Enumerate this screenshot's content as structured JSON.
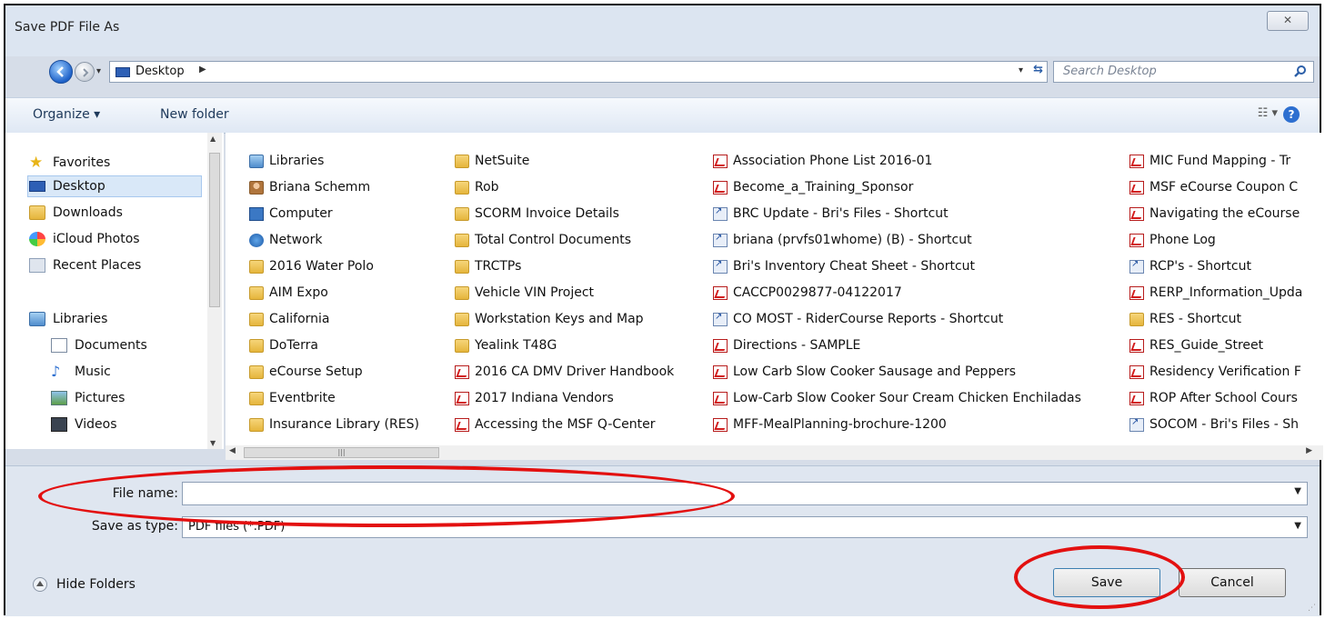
{
  "window": {
    "title": "Save PDF File As",
    "close_label": "✕"
  },
  "address_bar": {
    "location": "Desktop",
    "search_placeholder": "Search Desktop"
  },
  "toolbar": {
    "organize_label": "Organize ▾",
    "new_folder_label": "New folder",
    "views_label": "☷ ▾",
    "help_label": "?"
  },
  "nav_pane": {
    "items": [
      {
        "label": "Favorites",
        "icon": "star-icon"
      },
      {
        "label": "Desktop",
        "icon": "desktop-icon",
        "selected": true
      },
      {
        "label": "Downloads",
        "icon": "downloads-icon"
      },
      {
        "label": "iCloud Photos",
        "icon": "icloud-photos-icon"
      },
      {
        "label": "Recent Places",
        "icon": "recent-places-icon"
      },
      {
        "label": "Libraries",
        "icon": "libraries-icon"
      },
      {
        "label": "Documents",
        "icon": "documents-icon"
      },
      {
        "label": "Music",
        "icon": "music-icon"
      },
      {
        "label": "Pictures",
        "icon": "pictures-icon"
      },
      {
        "label": "Videos",
        "icon": "videos-icon"
      }
    ]
  },
  "files": {
    "columns": [
      [
        {
          "name": "Libraries",
          "icon": "library-icon"
        },
        {
          "name": "Briana Schemm",
          "icon": "user-folder-icon"
        },
        {
          "name": "Computer",
          "icon": "computer-icon"
        },
        {
          "name": "Network",
          "icon": "network-icon"
        },
        {
          "name": "2016 Water Polo",
          "icon": "folder-icon"
        },
        {
          "name": "AIM Expo",
          "icon": "folder-icon"
        },
        {
          "name": "California",
          "icon": "folder-icon"
        },
        {
          "name": "DoTerra",
          "icon": "folder-icon"
        },
        {
          "name": "eCourse Setup",
          "icon": "folder-icon"
        },
        {
          "name": "Eventbrite",
          "icon": "folder-icon"
        },
        {
          "name": "Insurance Library (RES)",
          "icon": "folder-icon"
        }
      ],
      [
        {
          "name": "NetSuite",
          "icon": "folder-icon"
        },
        {
          "name": "Rob",
          "icon": "folder-icon"
        },
        {
          "name": "SCORM Invoice Details",
          "icon": "folder-icon"
        },
        {
          "name": "Total Control Documents",
          "icon": "folder-icon"
        },
        {
          "name": "TRCTPs",
          "icon": "folder-icon"
        },
        {
          "name": "Vehicle VIN Project",
          "icon": "folder-icon"
        },
        {
          "name": "Workstation Keys and Map",
          "icon": "folder-icon"
        },
        {
          "name": "Yealink T48G",
          "icon": "folder-icon"
        },
        {
          "name": "2016 CA DMV Driver Handbook",
          "icon": "pdf-icon"
        },
        {
          "name": "2017 Indiana Vendors",
          "icon": "pdf-icon"
        },
        {
          "name": "Accessing the MSF Q-Center",
          "icon": "pdf-icon"
        }
      ],
      [
        {
          "name": "Association Phone List 2016-01",
          "icon": "pdf-icon"
        },
        {
          "name": "Become_a_Training_Sponsor",
          "icon": "pdf-icon"
        },
        {
          "name": "BRC Update - Bri's Files - Shortcut",
          "icon": "shortcut-icon"
        },
        {
          "name": "briana (prvfs01whome) (B) - Shortcut",
          "icon": "shortcut-icon"
        },
        {
          "name": "Bri's Inventory Cheat Sheet - Shortcut",
          "icon": "shortcut-icon"
        },
        {
          "name": "CACCP0029877-04122017",
          "icon": "pdf-icon"
        },
        {
          "name": "CO MOST - RiderCourse Reports - Shortcut",
          "icon": "shortcut-icon"
        },
        {
          "name": "Directions - SAMPLE",
          "icon": "pdf-icon"
        },
        {
          "name": "Low Carb Slow Cooker Sausage and Peppers",
          "icon": "pdf-icon"
        },
        {
          "name": "Low-Carb Slow Cooker Sour Cream Chicken Enchiladas",
          "icon": "pdf-icon"
        },
        {
          "name": "MFF-MealPlanning-brochure-1200",
          "icon": "pdf-icon"
        }
      ],
      [
        {
          "name": "MIC Fund Mapping - Tr",
          "icon": "pdf-icon"
        },
        {
          "name": "MSF eCourse Coupon C",
          "icon": "pdf-icon"
        },
        {
          "name": "Navigating the eCourse",
          "icon": "pdf-icon"
        },
        {
          "name": "Phone Log",
          "icon": "pdf-icon"
        },
        {
          "name": "RCP's - Shortcut",
          "icon": "shortcut-icon"
        },
        {
          "name": "RERP_Information_Upda",
          "icon": "pdf-icon"
        },
        {
          "name": "RES - Shortcut",
          "icon": "folder-icon"
        },
        {
          "name": "RES_Guide_Street",
          "icon": "pdf-icon"
        },
        {
          "name": "Residency Verification F",
          "icon": "pdf-icon"
        },
        {
          "name": "ROP After School Cours",
          "icon": "pdf-icon"
        },
        {
          "name": "SOCOM - Bri's Files - Sh",
          "icon": "shortcut-icon"
        }
      ]
    ]
  },
  "form": {
    "file_name_label": "File name:",
    "file_name_value": "",
    "save_type_label": "Save as type:",
    "save_type_value": "PDF files (*.PDF)"
  },
  "footer": {
    "hide_folders_label": "Hide Folders",
    "save_label": "Save",
    "cancel_label": "Cancel"
  },
  "colors": {
    "annotation": "#e31010",
    "accent": "#2d6fd0"
  }
}
